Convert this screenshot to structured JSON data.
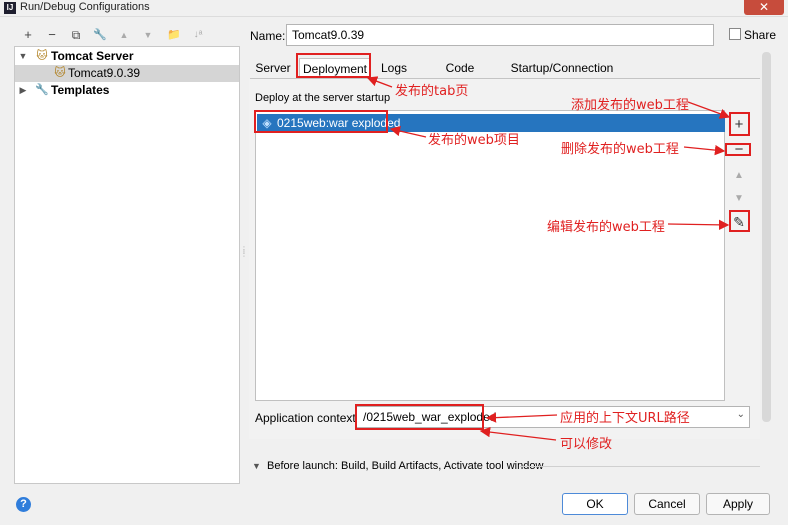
{
  "window": {
    "title": "Run/Debug Configurations",
    "close": "✕"
  },
  "toolbar": {
    "add": "+",
    "remove": "−",
    "copy": "⧉",
    "edit": "🔧",
    "up": "▲",
    "down": "▼",
    "folder": "📁",
    "sort": "↓ᵃ"
  },
  "tree": {
    "tomcat_server": "Tomcat Server",
    "tomcat_instance": "Tomcat9.0.39",
    "templates": "Templates"
  },
  "form": {
    "name_label": "Name:",
    "name_value": "Tomcat9.0.39",
    "share_label": "Share"
  },
  "tabs": [
    "Server",
    "Deployment",
    "Logs",
    "Code Coverage",
    "Startup/Connection"
  ],
  "deployment": {
    "section_label": "Deploy at the server startup",
    "items": [
      "0215web:war exploded"
    ],
    "side_buttons": {
      "add": "+",
      "remove": "−",
      "up": "▲",
      "down": "▼",
      "edit": "✎"
    }
  },
  "context": {
    "label": "Application context:",
    "value": "/0215web_war_exploded"
  },
  "before_launch": "Before launch: Build, Build Artifacts, Activate tool window",
  "buttons": {
    "help": "?",
    "ok": "OK",
    "cancel": "Cancel",
    "apply": "Apply"
  },
  "annotations": {
    "tab_page": "发布的tab页",
    "add_web": "添加发布的web工程",
    "web_project": "发布的web项目",
    "remove_web": "删除发布的web工程",
    "edit_web": "编辑发布的web工程",
    "context_path": "应用的上下文URL路径",
    "editable": "可以修改"
  }
}
